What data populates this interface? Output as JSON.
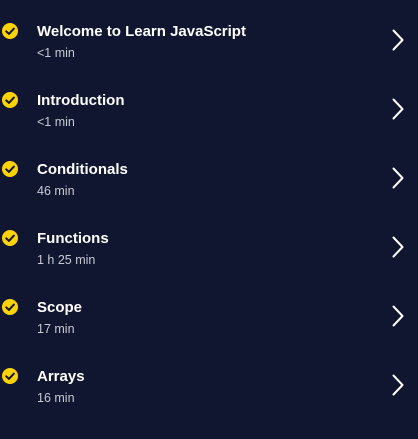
{
  "modules": [
    {
      "title": "Welcome to Learn JavaScript",
      "duration": "<1 min",
      "status_icon": "check-circle-icon",
      "nav_icon": "chevron-right-icon"
    },
    {
      "title": "Introduction",
      "duration": "<1 min",
      "status_icon": "check-circle-icon",
      "nav_icon": "chevron-right-icon"
    },
    {
      "title": "Conditionals",
      "duration": "46 min",
      "status_icon": "check-circle-icon",
      "nav_icon": "chevron-right-icon"
    },
    {
      "title": "Functions",
      "duration": "1 h 25 min",
      "status_icon": "check-circle-icon",
      "nav_icon": "chevron-right-icon"
    },
    {
      "title": "Scope",
      "duration": "17 min",
      "status_icon": "check-circle-icon",
      "nav_icon": "chevron-right-icon"
    },
    {
      "title": "Arrays",
      "duration": "16 min",
      "status_icon": "check-circle-icon",
      "nav_icon": "chevron-right-icon"
    }
  ],
  "colors": {
    "background": "#10162f",
    "check": "#ffd300",
    "title": "#ffffff",
    "duration": "#c7c9d3"
  }
}
